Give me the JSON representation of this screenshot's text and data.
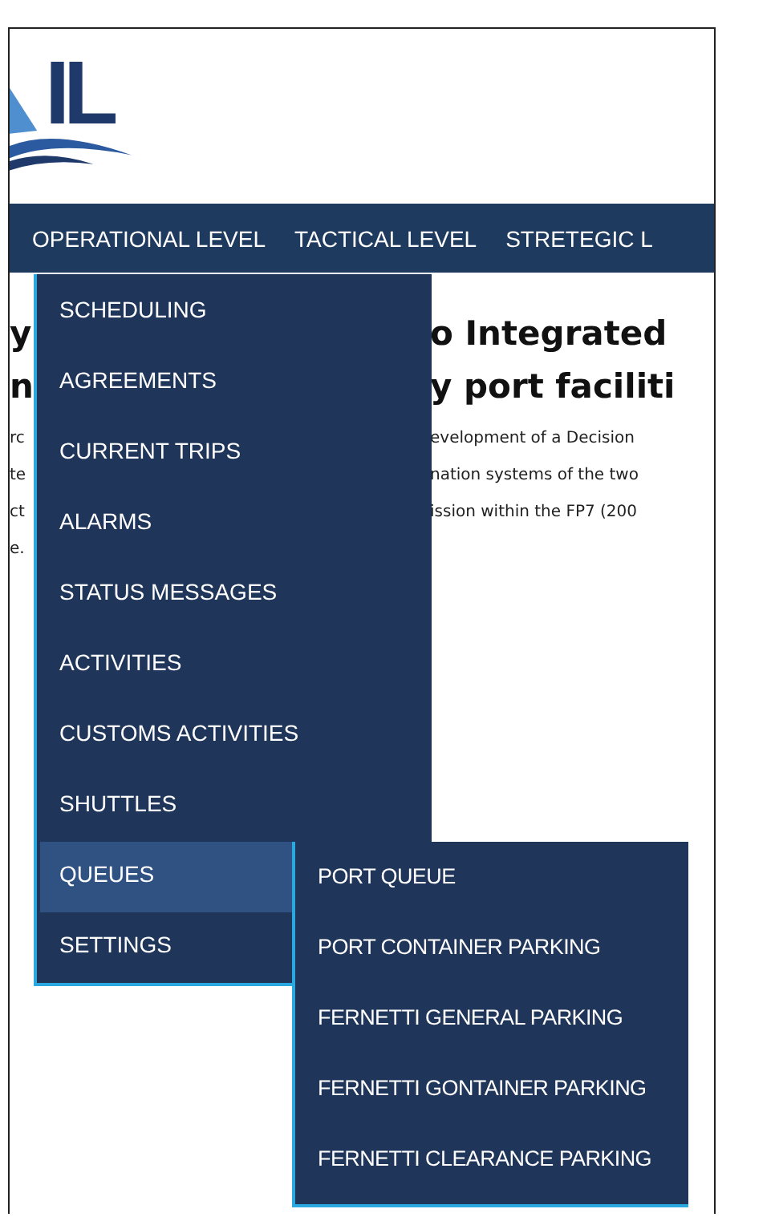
{
  "logo": {
    "text": "IL"
  },
  "nav": [
    {
      "label": "OPERATIONAL LEVEL"
    },
    {
      "label": "TACTICAL LEVEL"
    },
    {
      "label": "STRETEGIC L"
    }
  ],
  "heading_lines": [
    {
      "left": "y",
      "right": "o Integrated"
    },
    {
      "left": "n",
      "right": "y port faciliti"
    }
  ],
  "paragraph_lines": [
    {
      "left": "rc",
      "right": "evelopment of a Decision"
    },
    {
      "left": "te",
      "right": "nation systems of the two"
    },
    {
      "left": "ct",
      "right": "ission within the FP7 (200"
    },
    {
      "left": "e."
    }
  ],
  "menu": {
    "items": [
      {
        "label": "SCHEDULING",
        "selected": false
      },
      {
        "label": "AGREEMENTS",
        "selected": false
      },
      {
        "label": "CURRENT TRIPS",
        "selected": false
      },
      {
        "label": "ALARMS",
        "selected": false
      },
      {
        "label": "STATUS MESSAGES",
        "selected": false
      },
      {
        "label": "ACTIVITIES",
        "selected": false
      },
      {
        "label": "CUSTOMS ACTIVITIES",
        "selected": false
      },
      {
        "label": "SHUTTLES",
        "selected": false
      },
      {
        "label": "QUEUES",
        "selected": true
      },
      {
        "label": "SETTINGS",
        "selected": false
      }
    ]
  },
  "submenu": {
    "items": [
      {
        "label": "PORT QUEUE"
      },
      {
        "label": "PORT CONTAINER PARKING"
      },
      {
        "label": "FERNETTI GENERAL PARKING"
      },
      {
        "label": "FERNETTI GONTAINER PARKING"
      },
      {
        "label": "FERNETTI CLEARANCE PARKING"
      }
    ]
  }
}
